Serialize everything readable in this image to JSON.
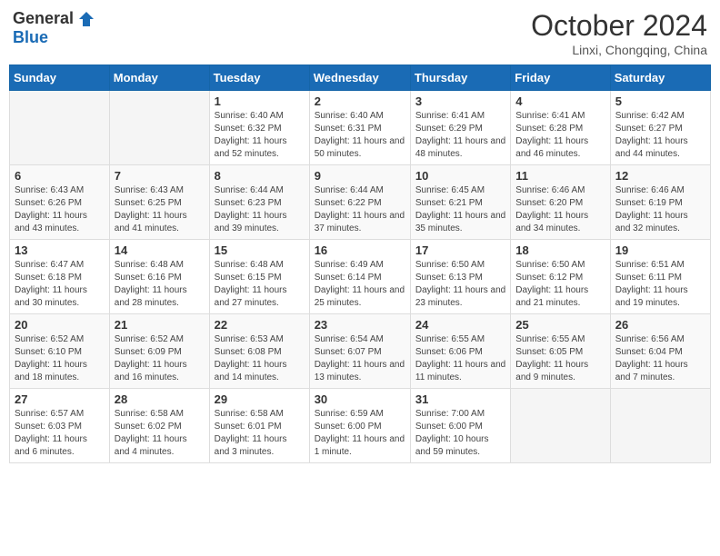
{
  "logo": {
    "general": "General",
    "blue": "Blue"
  },
  "header": {
    "title": "October 2024",
    "subtitle": "Linxi, Chongqing, China"
  },
  "weekdays": [
    "Sunday",
    "Monday",
    "Tuesday",
    "Wednesday",
    "Thursday",
    "Friday",
    "Saturday"
  ],
  "weeks": [
    [
      {
        "day": "",
        "info": ""
      },
      {
        "day": "",
        "info": ""
      },
      {
        "day": "1",
        "info": "Sunrise: 6:40 AM\nSunset: 6:32 PM\nDaylight: 11 hours and 52 minutes."
      },
      {
        "day": "2",
        "info": "Sunrise: 6:40 AM\nSunset: 6:31 PM\nDaylight: 11 hours and 50 minutes."
      },
      {
        "day": "3",
        "info": "Sunrise: 6:41 AM\nSunset: 6:29 PM\nDaylight: 11 hours and 48 minutes."
      },
      {
        "day": "4",
        "info": "Sunrise: 6:41 AM\nSunset: 6:28 PM\nDaylight: 11 hours and 46 minutes."
      },
      {
        "day": "5",
        "info": "Sunrise: 6:42 AM\nSunset: 6:27 PM\nDaylight: 11 hours and 44 minutes."
      }
    ],
    [
      {
        "day": "6",
        "info": "Sunrise: 6:43 AM\nSunset: 6:26 PM\nDaylight: 11 hours and 43 minutes."
      },
      {
        "day": "7",
        "info": "Sunrise: 6:43 AM\nSunset: 6:25 PM\nDaylight: 11 hours and 41 minutes."
      },
      {
        "day": "8",
        "info": "Sunrise: 6:44 AM\nSunset: 6:23 PM\nDaylight: 11 hours and 39 minutes."
      },
      {
        "day": "9",
        "info": "Sunrise: 6:44 AM\nSunset: 6:22 PM\nDaylight: 11 hours and 37 minutes."
      },
      {
        "day": "10",
        "info": "Sunrise: 6:45 AM\nSunset: 6:21 PM\nDaylight: 11 hours and 35 minutes."
      },
      {
        "day": "11",
        "info": "Sunrise: 6:46 AM\nSunset: 6:20 PM\nDaylight: 11 hours and 34 minutes."
      },
      {
        "day": "12",
        "info": "Sunrise: 6:46 AM\nSunset: 6:19 PM\nDaylight: 11 hours and 32 minutes."
      }
    ],
    [
      {
        "day": "13",
        "info": "Sunrise: 6:47 AM\nSunset: 6:18 PM\nDaylight: 11 hours and 30 minutes."
      },
      {
        "day": "14",
        "info": "Sunrise: 6:48 AM\nSunset: 6:16 PM\nDaylight: 11 hours and 28 minutes."
      },
      {
        "day": "15",
        "info": "Sunrise: 6:48 AM\nSunset: 6:15 PM\nDaylight: 11 hours and 27 minutes."
      },
      {
        "day": "16",
        "info": "Sunrise: 6:49 AM\nSunset: 6:14 PM\nDaylight: 11 hours and 25 minutes."
      },
      {
        "day": "17",
        "info": "Sunrise: 6:50 AM\nSunset: 6:13 PM\nDaylight: 11 hours and 23 minutes."
      },
      {
        "day": "18",
        "info": "Sunrise: 6:50 AM\nSunset: 6:12 PM\nDaylight: 11 hours and 21 minutes."
      },
      {
        "day": "19",
        "info": "Sunrise: 6:51 AM\nSunset: 6:11 PM\nDaylight: 11 hours and 19 minutes."
      }
    ],
    [
      {
        "day": "20",
        "info": "Sunrise: 6:52 AM\nSunset: 6:10 PM\nDaylight: 11 hours and 18 minutes."
      },
      {
        "day": "21",
        "info": "Sunrise: 6:52 AM\nSunset: 6:09 PM\nDaylight: 11 hours and 16 minutes."
      },
      {
        "day": "22",
        "info": "Sunrise: 6:53 AM\nSunset: 6:08 PM\nDaylight: 11 hours and 14 minutes."
      },
      {
        "day": "23",
        "info": "Sunrise: 6:54 AM\nSunset: 6:07 PM\nDaylight: 11 hours and 13 minutes."
      },
      {
        "day": "24",
        "info": "Sunrise: 6:55 AM\nSunset: 6:06 PM\nDaylight: 11 hours and 11 minutes."
      },
      {
        "day": "25",
        "info": "Sunrise: 6:55 AM\nSunset: 6:05 PM\nDaylight: 11 hours and 9 minutes."
      },
      {
        "day": "26",
        "info": "Sunrise: 6:56 AM\nSunset: 6:04 PM\nDaylight: 11 hours and 7 minutes."
      }
    ],
    [
      {
        "day": "27",
        "info": "Sunrise: 6:57 AM\nSunset: 6:03 PM\nDaylight: 11 hours and 6 minutes."
      },
      {
        "day": "28",
        "info": "Sunrise: 6:58 AM\nSunset: 6:02 PM\nDaylight: 11 hours and 4 minutes."
      },
      {
        "day": "29",
        "info": "Sunrise: 6:58 AM\nSunset: 6:01 PM\nDaylight: 11 hours and 3 minutes."
      },
      {
        "day": "30",
        "info": "Sunrise: 6:59 AM\nSunset: 6:00 PM\nDaylight: 11 hours and 1 minute."
      },
      {
        "day": "31",
        "info": "Sunrise: 7:00 AM\nSunset: 6:00 PM\nDaylight: 10 hours and 59 minutes."
      },
      {
        "day": "",
        "info": ""
      },
      {
        "day": "",
        "info": ""
      }
    ]
  ]
}
